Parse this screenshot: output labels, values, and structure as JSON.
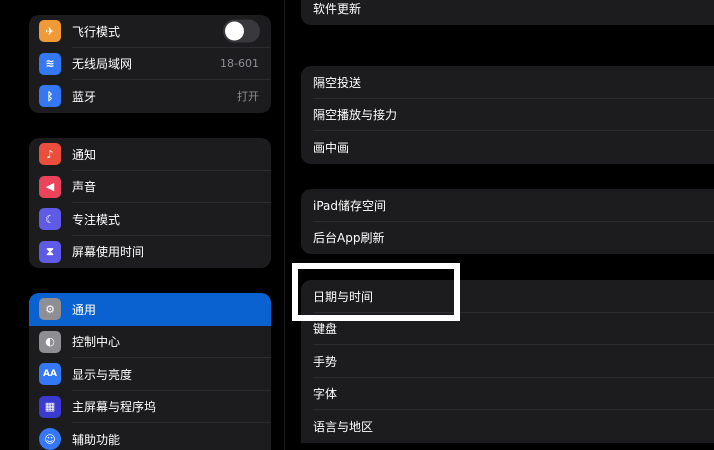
{
  "sidebar": {
    "groups": [
      {
        "items": [
          {
            "label": "飞行模式",
            "icon": "airplane-icon",
            "color": "#f09a37",
            "glyph": "✈"
          },
          {
            "label": "无线局域网",
            "value": "18-601",
            "icon": "wifi-icon",
            "color": "#3478f6",
            "glyph": "≋"
          },
          {
            "label": "蓝牙",
            "value": "打开",
            "icon": "bluetooth-icon",
            "color": "#3478f6",
            "glyph": "ᛒ"
          }
        ]
      },
      {
        "items": [
          {
            "label": "通知",
            "icon": "bell-icon",
            "color": "#eb4e3d",
            "glyph": "♪"
          },
          {
            "label": "声音",
            "icon": "speaker-icon",
            "color": "#eb445a",
            "glyph": "◀"
          },
          {
            "label": "专注模式",
            "icon": "moon-icon",
            "color": "#5e5ce6",
            "glyph": "☾"
          },
          {
            "label": "屏幕使用时间",
            "icon": "hourglass-icon",
            "color": "#5e5ce6",
            "glyph": "⧗"
          }
        ]
      },
      {
        "items": [
          {
            "label": "通用",
            "icon": "gear-icon",
            "color": "#8e8e93",
            "glyph": "⚙"
          },
          {
            "label": "控制中心",
            "icon": "toggles-icon",
            "color": "#8e8e93",
            "glyph": "◐"
          },
          {
            "label": "显示与亮度",
            "icon": "text-size-icon",
            "color": "#3478f6",
            "glyph": "AA"
          },
          {
            "label": "主屏幕与程序坞",
            "icon": "grid-icon",
            "color": "#3a3ad0",
            "glyph": "▦"
          },
          {
            "label": "辅助功能",
            "icon": "accessibility-icon",
            "color": "#3478f6",
            "glyph": "☺"
          }
        ]
      }
    ]
  },
  "main": {
    "groups": [
      {
        "items": [
          "软件更新"
        ]
      },
      {
        "items": [
          "隔空投送",
          "隔空播放与接力",
          "画中画"
        ]
      },
      {
        "items": [
          "iPad储存空间",
          "后台App刷新"
        ]
      },
      {
        "items": [
          "日期与时间",
          "键盘",
          "手势",
          "字体",
          "语言与地区"
        ]
      }
    ]
  },
  "colors": {
    "selected": "#0a62d0",
    "highlight_box": "#ffffff"
  }
}
